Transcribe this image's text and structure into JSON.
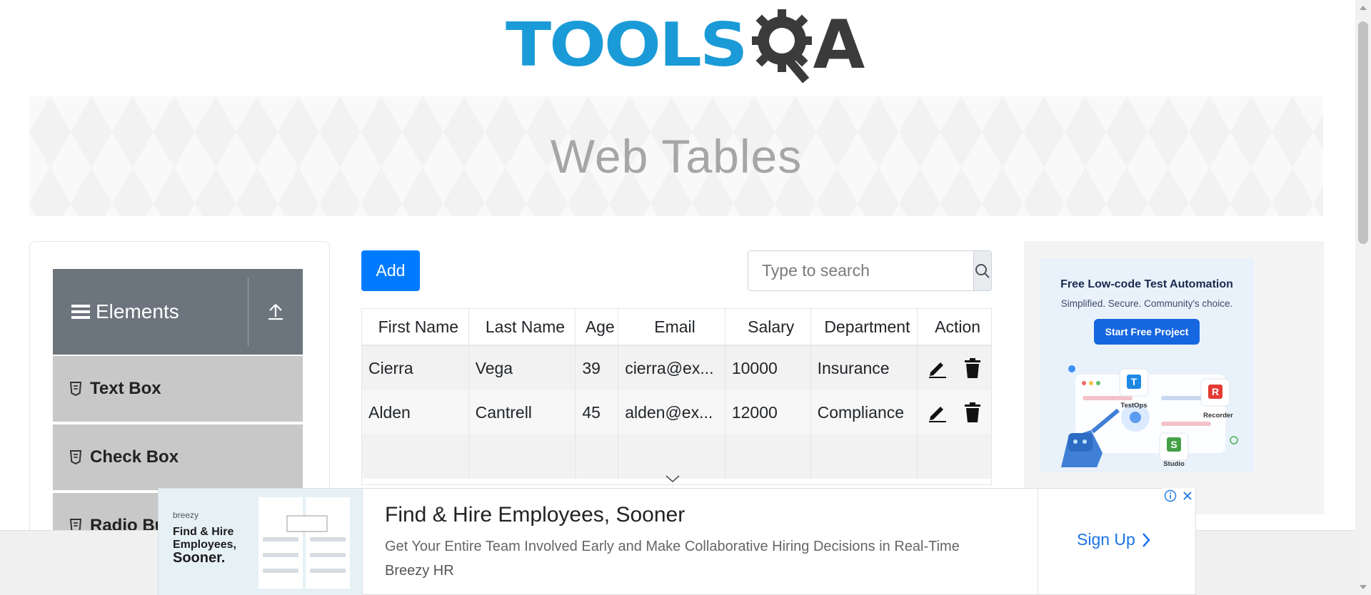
{
  "logo": {
    "text_tools": "TOOLS",
    "text_q": "Q",
    "text_a": "A",
    "colors": {
      "tools": "#1a9bd7",
      "qa": "#3b3b3b"
    }
  },
  "banner": {
    "title": "Web Tables"
  },
  "sidebar": {
    "group_label": "Elements",
    "group_icon": "hamburger-icon",
    "collapse_icon": "upload-arrow-icon",
    "items": [
      {
        "label": "Text Box",
        "icon": "html5-icon"
      },
      {
        "label": "Check Box",
        "icon": "html5-icon"
      },
      {
        "label": "Radio Bu",
        "icon": "html5-icon"
      }
    ]
  },
  "toolbar": {
    "add_label": "Add",
    "search_placeholder": "Type to search",
    "search_value": ""
  },
  "table": {
    "headers": [
      "First Name",
      "Last Name",
      "Age",
      "Email",
      "Salary",
      "Department",
      "Action"
    ],
    "rows": [
      {
        "first": "Cierra",
        "last": "Vega",
        "age": "39",
        "email": "cierra@ex...",
        "salary": "10000",
        "department": "Insurance"
      },
      {
        "first": "Alden",
        "last": "Cantrell",
        "age": "45",
        "email": "alden@ex...",
        "salary": "12000",
        "department": "Compliance"
      }
    ]
  },
  "right_ad": {
    "title": "Free Low-code Test Automation",
    "subtitle": "Simplified. Secure. Community's choice.",
    "cta": "Start Free Project",
    "labels": {
      "testops": "TestOps",
      "recorder": "Recorder",
      "studio": "Studio"
    },
    "badges": {
      "testops": "T",
      "recorder": "R",
      "studio": "S"
    }
  },
  "bottom_ad": {
    "brand": "breezy",
    "thumb_line1": "Find & Hire",
    "thumb_line2": "Employees,",
    "thumb_line3": "Sooner.",
    "headline": "Find & Hire Employees, Sooner",
    "description": "Get Your Entire Team Involved Early and Make Collaborative Hiring Decisions in Real-Time",
    "advertiser": "Breezy HR",
    "cta": "Sign Up"
  },
  "colors": {
    "primary": "#007bff",
    "sidebar_header": "#6c757d",
    "sidebar_item": "#c8c8c8",
    "link": "#1a73e8"
  }
}
